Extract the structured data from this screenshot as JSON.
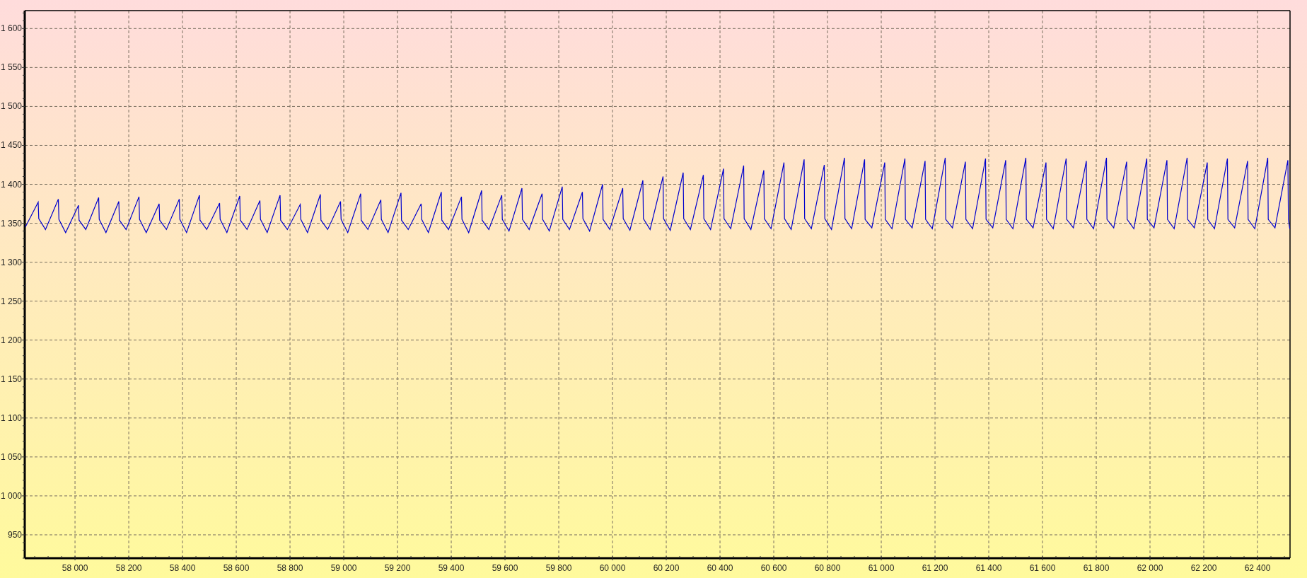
{
  "chart_data": {
    "type": "line",
    "grid": true,
    "xlim": [
      57813,
      62521
    ],
    "ylim": [
      920,
      1623
    ],
    "xticks": [
      {
        "value": 58000,
        "label": "58 000"
      },
      {
        "value": 58200,
        "label": "58 200"
      },
      {
        "value": 58400,
        "label": "58 400"
      },
      {
        "value": 58600,
        "label": "58 600"
      },
      {
        "value": 58800,
        "label": "58 800"
      },
      {
        "value": 59000,
        "label": "59 000"
      },
      {
        "value": 59200,
        "label": "59 200"
      },
      {
        "value": 59400,
        "label": "59 400"
      },
      {
        "value": 59600,
        "label": "59 600"
      },
      {
        "value": 59800,
        "label": "59 800"
      },
      {
        "value": 60000,
        "label": "60 000"
      },
      {
        "value": 60200,
        "label": "60 200"
      },
      {
        "value": 60400,
        "label": "60 400"
      },
      {
        "value": 60600,
        "label": "60 600"
      },
      {
        "value": 60800,
        "label": "60 800"
      },
      {
        "value": 61000,
        "label": "61 000"
      },
      {
        "value": 61200,
        "label": "61 200"
      },
      {
        "value": 61400,
        "label": "61 400"
      },
      {
        "value": 61600,
        "label": "61 600"
      },
      {
        "value": 61800,
        "label": "61 800"
      },
      {
        "value": 62000,
        "label": "62 000"
      },
      {
        "value": 62200,
        "label": "62 200"
      },
      {
        "value": 62400,
        "label": "62 400"
      }
    ],
    "yticks": [
      {
        "value": 950,
        "label": "950"
      },
      {
        "value": 1000,
        "label": "1 000"
      },
      {
        "value": 1050,
        "label": "1 050"
      },
      {
        "value": 1100,
        "label": "1 100"
      },
      {
        "value": 1150,
        "label": "1 150"
      },
      {
        "value": 1200,
        "label": "1 200"
      },
      {
        "value": 1250,
        "label": "1 250"
      },
      {
        "value": 1300,
        "label": "1 300"
      },
      {
        "value": 1350,
        "label": "1 350"
      },
      {
        "value": 1400,
        "label": "1 400"
      },
      {
        "value": 1450,
        "label": "1 450"
      },
      {
        "value": 1500,
        "label": "1 500"
      },
      {
        "value": 1550,
        "label": "1 550"
      },
      {
        "value": 1600,
        "label": "1 600"
      }
    ],
    "x": [
      57815,
      57863,
      57865,
      57890,
      57938,
      57940,
      57965,
      58013,
      58015,
      58040,
      58088,
      58090,
      58115,
      58163,
      58165,
      58190,
      58238,
      58240,
      58265,
      58313,
      58315,
      58340,
      58388,
      58390,
      58415,
      58463,
      58465,
      58490,
      58538,
      58540,
      58565,
      58613,
      58615,
      58640,
      58688,
      58690,
      58715,
      58763,
      58765,
      58790,
      58838,
      58840,
      58865,
      58913,
      58915,
      58940,
      58988,
      58990,
      59015,
      59063,
      59065,
      59090,
      59138,
      59140,
      59165,
      59213,
      59215,
      59240,
      59288,
      59290,
      59315,
      59363,
      59365,
      59390,
      59438,
      59440,
      59465,
      59513,
      59515,
      59540,
      59588,
      59590,
      59615,
      59663,
      59665,
      59690,
      59738,
      59740,
      59765,
      59813,
      59815,
      59840,
      59888,
      59890,
      59915,
      59963,
      59965,
      59990,
      60038,
      60040,
      60065,
      60113,
      60115,
      60140,
      60188,
      60190,
      60215,
      60263,
      60265,
      60290,
      60338,
      60340,
      60365,
      60413,
      60415,
      60440,
      60488,
      60490,
      60515,
      60563,
      60565,
      60590,
      60638,
      60640,
      60665,
      60713,
      60715,
      60740,
      60788,
      60790,
      60815,
      60863,
      60865,
      60890,
      60938,
      60940,
      60965,
      61013,
      61015,
      61040,
      61088,
      61090,
      61115,
      61163,
      61165,
      61190,
      61238,
      61240,
      61265,
      61313,
      61315,
      61340,
      61388,
      61390,
      61415,
      61463,
      61465,
      61490,
      61538,
      61540,
      61565,
      61613,
      61615,
      61640,
      61688,
      61690,
      61715,
      61763,
      61765,
      61790,
      61838,
      61840,
      61865,
      61913,
      61915,
      61940,
      61988,
      61990,
      62015,
      62063,
      62065,
      62090,
      62138,
      62140,
      62165,
      62213,
      62215,
      62240,
      62288,
      62290,
      62315,
      62363,
      62365,
      62390,
      62438,
      62440,
      62465,
      62513,
      62515,
      62520
    ],
    "series": [
      {
        "color": "#0000cc",
        "values": [
          1345,
          1377,
          1356,
          1342,
          1381,
          1355,
          1338,
          1373,
          1354,
          1342,
          1383,
          1355,
          1338,
          1378,
          1354,
          1342,
          1384,
          1355,
          1338,
          1375,
          1354,
          1342,
          1381,
          1355,
          1338,
          1386,
          1354,
          1342,
          1376,
          1355,
          1338,
          1385,
          1354,
          1342,
          1379,
          1355,
          1338,
          1386,
          1354,
          1342,
          1374,
          1355,
          1338,
          1387,
          1354,
          1342,
          1378,
          1355,
          1338,
          1388,
          1354,
          1342,
          1380,
          1355,
          1338,
          1389,
          1354,
          1342,
          1375,
          1355,
          1338,
          1390,
          1354,
          1342,
          1384,
          1355,
          1338,
          1392,
          1354,
          1342,
          1386,
          1355,
          1340,
          1395,
          1355,
          1342,
          1388,
          1355,
          1340,
          1397,
          1355,
          1342,
          1390,
          1356,
          1340,
          1400,
          1355,
          1342,
          1395,
          1356,
          1341,
          1405,
          1356,
          1342,
          1410,
          1356,
          1341,
          1415,
          1356,
          1342,
          1412,
          1356,
          1342,
          1420,
          1356,
          1343,
          1424,
          1356,
          1342,
          1418,
          1356,
          1343,
          1428,
          1356,
          1342,
          1432,
          1356,
          1343,
          1425,
          1356,
          1342,
          1434,
          1356,
          1343,
          1432,
          1355,
          1344,
          1428,
          1355,
          1343,
          1433,
          1355,
          1344,
          1430,
          1355,
          1343,
          1434,
          1355,
          1344,
          1429,
          1355,
          1343,
          1433,
          1355,
          1344,
          1431,
          1355,
          1343,
          1434,
          1355,
          1344,
          1428,
          1355,
          1343,
          1433,
          1355,
          1344,
          1430,
          1355,
          1343,
          1434,
          1355,
          1344,
          1429,
          1355,
          1343,
          1433,
          1355,
          1344,
          1431,
          1355,
          1343,
          1434,
          1355,
          1344,
          1428,
          1355,
          1343,
          1433,
          1355,
          1344,
          1430,
          1355,
          1343,
          1434,
          1355,
          1344,
          1431,
          1355,
          1343
        ]
      }
    ]
  }
}
